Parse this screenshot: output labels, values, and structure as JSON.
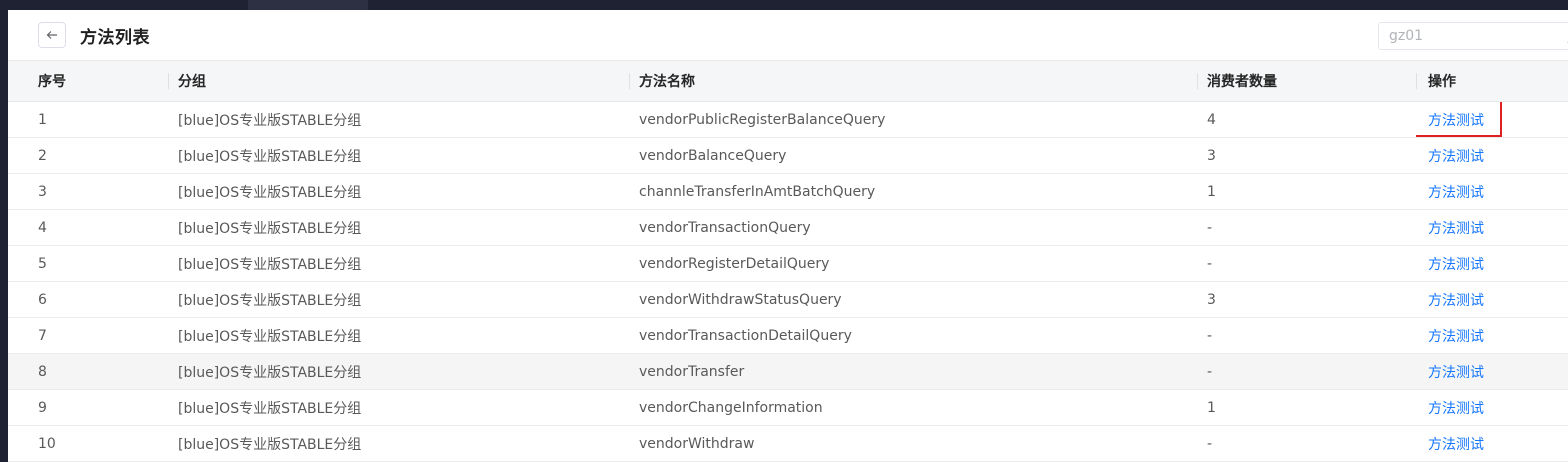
{
  "header": {
    "title": "方法列表",
    "env_value": "gz01"
  },
  "table": {
    "columns": [
      "序号",
      "分组",
      "方法名称",
      "消费者数量",
      "操作"
    ],
    "rows": [
      {
        "index": "1",
        "group": "[blue]OS专业版STABLE分组",
        "method": "vendorPublicRegisterBalanceQuery",
        "consumers": "4",
        "action": "方法测试"
      },
      {
        "index": "2",
        "group": "[blue]OS专业版STABLE分组",
        "method": "vendorBalanceQuery",
        "consumers": "3",
        "action": "方法测试"
      },
      {
        "index": "3",
        "group": "[blue]OS专业版STABLE分组",
        "method": "channleTransferInAmtBatchQuery",
        "consumers": "1",
        "action": "方法测试"
      },
      {
        "index": "4",
        "group": "[blue]OS专业版STABLE分组",
        "method": "vendorTransactionQuery",
        "consumers": "-",
        "action": "方法测试"
      },
      {
        "index": "5",
        "group": "[blue]OS专业版STABLE分组",
        "method": "vendorRegisterDetailQuery",
        "consumers": "-",
        "action": "方法测试"
      },
      {
        "index": "6",
        "group": "[blue]OS专业版STABLE分组",
        "method": "vendorWithdrawStatusQuery",
        "consumers": "3",
        "action": "方法测试"
      },
      {
        "index": "7",
        "group": "[blue]OS专业版STABLE分组",
        "method": "vendorTransactionDetailQuery",
        "consumers": "-",
        "action": "方法测试"
      },
      {
        "index": "8",
        "group": "[blue]OS专业版STABLE分组",
        "method": "vendorTransfer",
        "consumers": "-",
        "action": "方法测试"
      },
      {
        "index": "9",
        "group": "[blue]OS专业版STABLE分组",
        "method": "vendorChangeInformation",
        "consumers": "1",
        "action": "方法测试"
      },
      {
        "index": "10",
        "group": "[blue]OS专业版STABLE分组",
        "method": "vendorWithdraw",
        "consumers": "-",
        "action": "方法测试"
      }
    ]
  },
  "colors": {
    "link": "#1677ff",
    "highlight_box": "#e02020",
    "topbar": "#1f2233"
  },
  "icons": {
    "back": "arrow-left-icon",
    "select": "chevron-down-icon"
  }
}
